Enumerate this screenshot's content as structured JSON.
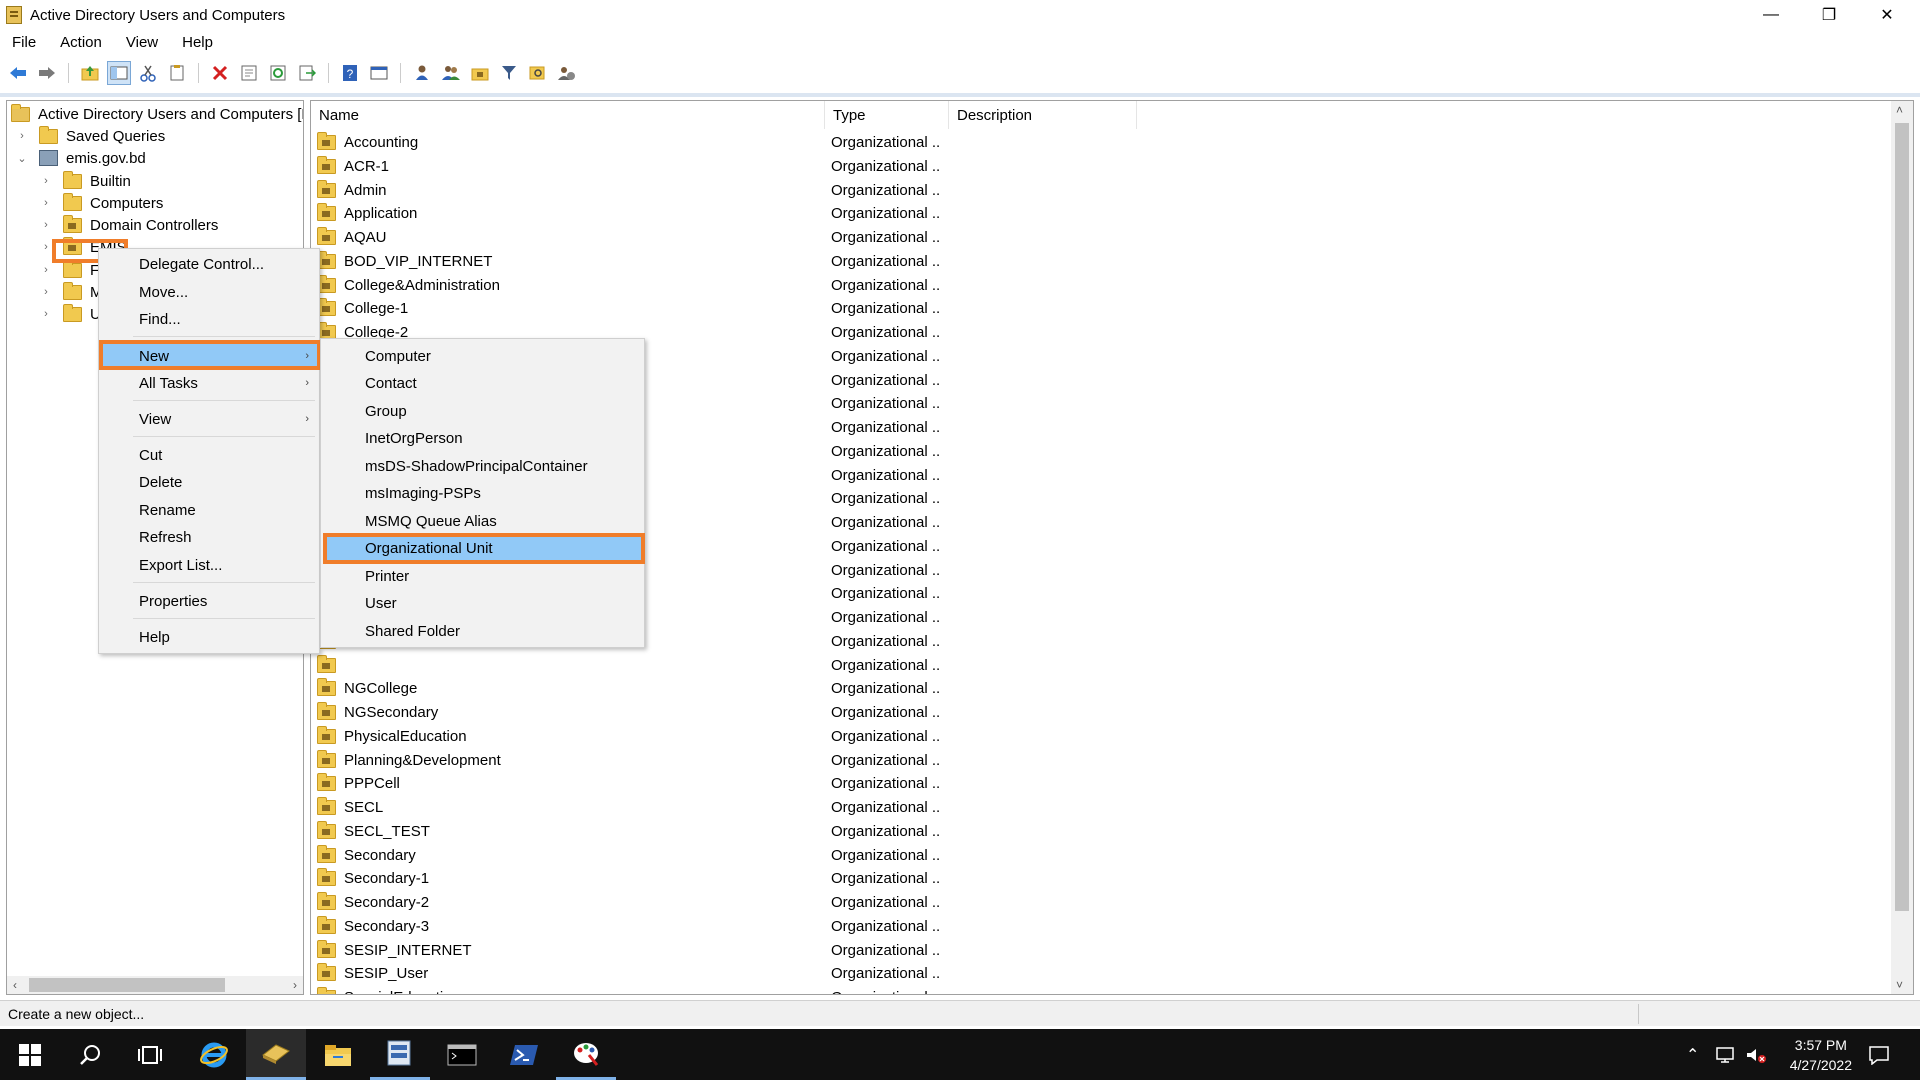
{
  "window": {
    "title": "Active Directory Users and Computers",
    "minimize_glyph": "—",
    "restore_glyph": "❐",
    "close_glyph": "✕"
  },
  "menu": [
    "File",
    "Action",
    "View",
    "Help"
  ],
  "toolbar_icons": [
    "back-icon",
    "forward-icon",
    "up-icon",
    "show-hide-tree-icon",
    "cut-icon",
    "copy-icon",
    "delete-icon",
    "properties-icon",
    "refresh-icon",
    "export-icon",
    "help-icon",
    "console-icon",
    "new-user-icon",
    "new-group-icon",
    "new-ou-icon",
    "filter-icon",
    "find-icon",
    "add-to-group-icon"
  ],
  "tree": {
    "root": "Active Directory Users and Computers [PD",
    "saved_queries": "Saved Queries",
    "domain": "emis.gov.bd",
    "children": [
      "Builtin",
      "Computers",
      "Domain Controllers",
      "EMIS",
      "Fo",
      "M",
      "Us"
    ]
  },
  "list": {
    "columns": [
      "Name",
      "Type",
      "Description"
    ],
    "type_value": "Organizational ...",
    "rows": [
      "Accounting",
      "ACR-1",
      "Admin",
      "Application",
      "AQAU",
      "BOD_VIP_INTERNET",
      "College&Administration",
      "College-1",
      "College-2",
      "",
      "",
      "",
      "",
      "",
      "",
      "",
      "",
      "",
      "",
      "",
      "",
      "",
      "",
      "NGCollege",
      "NGSecondary",
      "PhysicalEducation",
      "Planning&Development",
      "PPPCell",
      "SECL",
      "SECL_TEST",
      "Secondary",
      "Secondary-1",
      "Secondary-2",
      "Secondary-3",
      "SESIP_INTERNET",
      "SESIP_User",
      "SpecialEducation"
    ]
  },
  "context_menu": {
    "items": [
      "Delegate Control...",
      "Move...",
      "Find...",
      "New",
      "All Tasks",
      "View",
      "Cut",
      "Delete",
      "Rename",
      "Refresh",
      "Export List...",
      "Properties",
      "Help"
    ]
  },
  "submenu": {
    "items": [
      "Computer",
      "Contact",
      "Group",
      "InetOrgPerson",
      "msDS-ShadowPrincipalContainer",
      "msImaging-PSPs",
      "MSMQ Queue Alias",
      "Organizational Unit",
      "Printer",
      "User",
      "Shared Folder"
    ]
  },
  "status": "Create a new object...",
  "taskbar": {
    "time": "3:57 PM",
    "date": "4/27/2022"
  }
}
